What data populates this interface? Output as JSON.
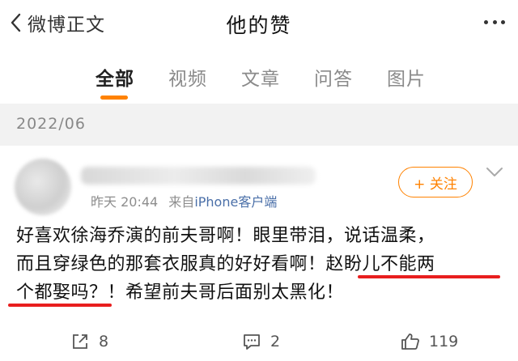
{
  "header": {
    "back_label": "微博正文",
    "title": "他的赞"
  },
  "tabs": [
    {
      "label": "全部",
      "active": true
    },
    {
      "label": "视频",
      "active": false
    },
    {
      "label": "文章",
      "active": false
    },
    {
      "label": "问答",
      "active": false
    },
    {
      "label": "图片",
      "active": false
    }
  ],
  "date_header": "2022/06",
  "post": {
    "time": "昨天 20:44",
    "source_prefix": "来自",
    "source": "iPhone客户端",
    "follow_label": "+ 关注",
    "text_lines": [
      {
        "a": "好喜欢徐海乔演的前夫哥啊！眼里带泪，说话温柔，",
        "b": ""
      },
      {
        "a": "而且穿绿色的那套衣服真的好好看啊！",
        "b": "赵盼儿不能两"
      },
      {
        "a": "个都娶吗？",
        "b": "！希望前夫哥后面别太黑化！"
      }
    ],
    "reposts": "8",
    "comments": "2",
    "likes": "119"
  },
  "colors": {
    "accent": "#ff8200",
    "annotation": "#e81e1e",
    "link": "#4a6fa8"
  }
}
